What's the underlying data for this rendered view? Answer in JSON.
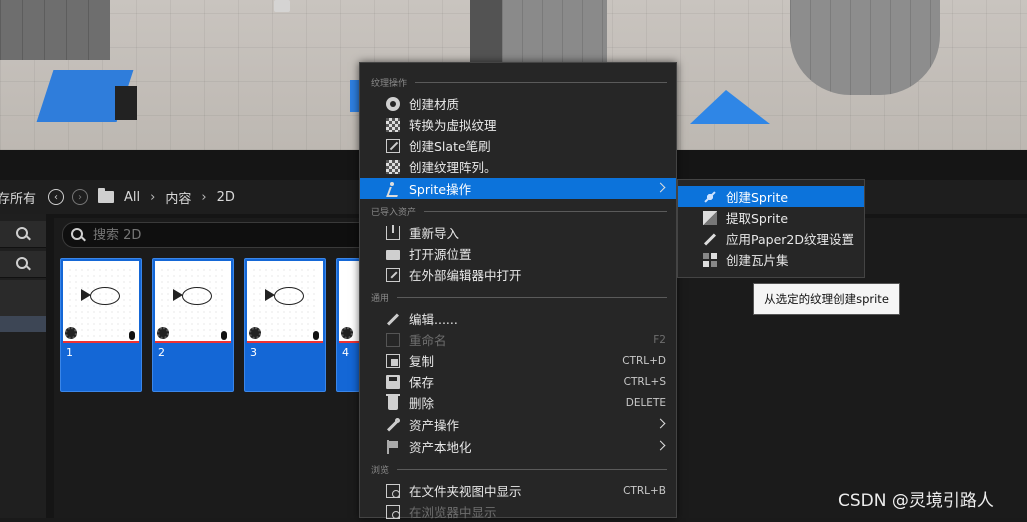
{
  "pathbar": {
    "save_all": "保存所有",
    "crumbs": [
      "All",
      "内容",
      "2D"
    ]
  },
  "search": {
    "placeholder": "搜索 2D"
  },
  "assets": [
    {
      "name": "1"
    },
    {
      "name": "2"
    },
    {
      "name": "3"
    },
    {
      "name": "4"
    }
  ],
  "menu": {
    "sections": {
      "texture_actions": "纹理操作",
      "imported_asset": "已导入资产",
      "common": "通用",
      "browse": "浏览"
    },
    "items": {
      "create_material": "创建材质",
      "convert_virtual": "转换为虚拟纹理",
      "create_slate_brush": "创建Slate笔刷",
      "create_texture_array": "创建纹理阵列。",
      "sprite_actions": "Sprite操作",
      "reimport": "重新导入",
      "open_source_location": "打开源位置",
      "open_in_external_editor": "在外部编辑器中打开",
      "edit": "编辑......",
      "rename": "重命名",
      "rename_shortcut": "F2",
      "duplicate": "复制",
      "duplicate_shortcut": "CTRL+D",
      "save": "保存",
      "save_shortcut": "CTRL+S",
      "delete": "删除",
      "delete_shortcut": "DELETE",
      "asset_actions": "资产操作",
      "asset_localization": "资产本地化",
      "show_in_folder_view": "在文件夹视图中显示",
      "show_in_folder_view_shortcut": "CTRL+B",
      "show_in_browser": "在浏览器中显示"
    }
  },
  "submenu": {
    "create_sprite": "创建Sprite",
    "extract_sprites": "提取Sprite",
    "apply_paper2d_settings": "应用Paper2D纹理设置",
    "create_tile_set": "创建瓦片集"
  },
  "tooltip": {
    "text": "从选定的纹理创建sprite"
  },
  "watermark": "CSDN @灵境引路人",
  "colors": {
    "highlight": "#0c73db",
    "menu_bg": "#262626",
    "tile_blue": "#1467d6"
  }
}
